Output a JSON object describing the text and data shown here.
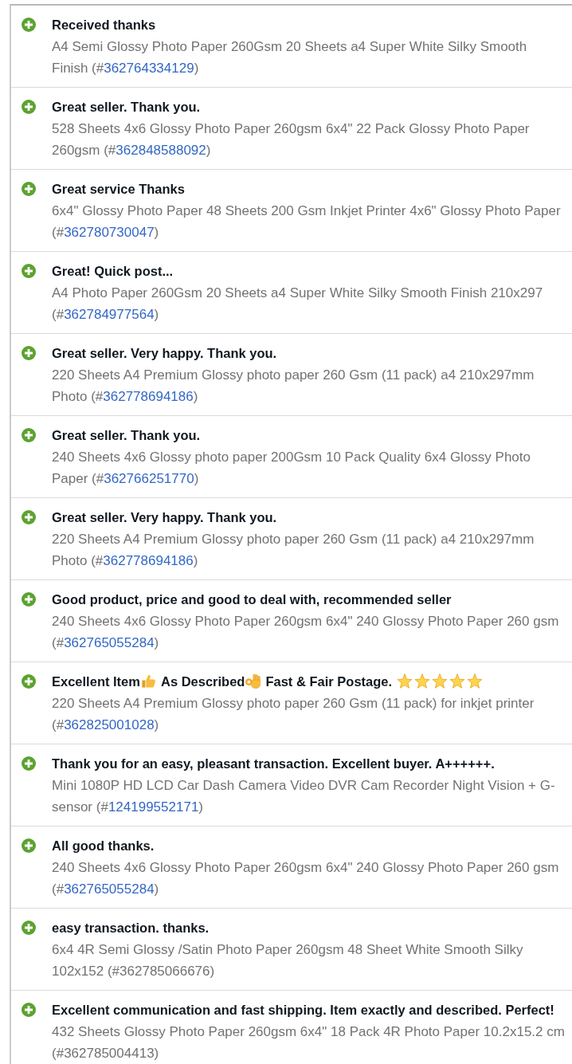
{
  "feedback": [
    {
      "positive": true,
      "comment": [
        {
          "kind": "text",
          "text": "Received thanks"
        }
      ],
      "item": "A4 Semi Glossy Photo Paper 260Gsm 20 Sheets a4 Super White Silky Smooth Finish",
      "open": "(#",
      "number": "362764334129",
      "close": ")",
      "linked": true
    },
    {
      "positive": true,
      "comment": [
        {
          "kind": "text",
          "text": "Great seller. Thank you."
        }
      ],
      "item": "528 Sheets 4x6 Glossy Photo Paper 260gsm 6x4\" 22 Pack Glossy Photo Paper 260gsm",
      "open": "(#",
      "number": "362848588092",
      "close": ")",
      "linked": true
    },
    {
      "positive": true,
      "comment": [
        {
          "kind": "text",
          "text": "Great service Thanks"
        }
      ],
      "item": "6x4\" Glossy Photo Paper 48 Sheets 200 Gsm Inkjet Printer 4x6\" Glossy Photo Paper",
      "open": "(#",
      "number": "362780730047",
      "close": ")",
      "linked": true
    },
    {
      "positive": true,
      "comment": [
        {
          "kind": "text",
          "text": "Great! Quick post..."
        }
      ],
      "item": "A4 Photo Paper 260Gsm 20 Sheets a4 Super White Silky Smooth Finish 210x297",
      "open": "(#",
      "number": "362784977564",
      "close": ")",
      "linked": true
    },
    {
      "positive": true,
      "comment": [
        {
          "kind": "text",
          "text": "Great seller. Very happy. Thank you."
        }
      ],
      "item": "220 Sheets A4 Premium Glossy photo paper 260 Gsm (11 pack) a4 210x297mm Photo",
      "open": "(#",
      "number": "362778694186",
      "close": ")",
      "linked": true
    },
    {
      "positive": true,
      "comment": [
        {
          "kind": "text",
          "text": "Great seller. Thank you."
        }
      ],
      "item": "240 Sheets 4x6 Glossy photo paper 200Gsm 10 Pack Quality 6x4 Glossy Photo Paper",
      "open": "(#",
      "number": "362766251770",
      "close": ")",
      "linked": true
    },
    {
      "positive": true,
      "comment": [
        {
          "kind": "text",
          "text": "Great seller. Very happy. Thank you."
        }
      ],
      "item": "220 Sheets A4 Premium Glossy photo paper 260 Gsm (11 pack) a4 210x297mm Photo",
      "open": "(#",
      "number": "362778694186",
      "close": ")",
      "linked": true
    },
    {
      "positive": true,
      "comment": [
        {
          "kind": "text",
          "text": "Good product, price and good to deal with, recommended seller"
        }
      ],
      "item": "240 Sheets 4x6 Glossy Photo Paper 260gsm 6x4\" 240 Glossy Photo Paper 260 gsm",
      "open": "(#",
      "number": "362765055284",
      "close": ")",
      "linked": true
    },
    {
      "positive": true,
      "comment": [
        {
          "kind": "text",
          "text": "Excellent Item"
        },
        {
          "kind": "thumbs_up"
        },
        {
          "kind": "text",
          "text": "As Described"
        },
        {
          "kind": "ok_hand"
        },
        {
          "kind": "text",
          "text": "Fast & Fair Postage."
        },
        {
          "kind": "star"
        },
        {
          "kind": "star"
        },
        {
          "kind": "star"
        },
        {
          "kind": "star"
        },
        {
          "kind": "star"
        }
      ],
      "item": "220 Sheets A4 Premium Glossy photo paper 260 Gsm (11 pack) for inkjet printer",
      "open": "(#",
      "number": "362825001028",
      "close": ")",
      "linked": true
    },
    {
      "positive": true,
      "comment": [
        {
          "kind": "text",
          "text": "Thank you for an easy, pleasant transaction. Excellent buyer. A++++++."
        }
      ],
      "item": "Mini 1080P HD LCD Car Dash Camera Video DVR Cam Recorder Night Vision + G-sensor",
      "open": "(#",
      "number": "124199552171",
      "close": ")",
      "linked": true
    },
    {
      "positive": true,
      "comment": [
        {
          "kind": "text",
          "text": "All good thanks."
        }
      ],
      "item": "240 Sheets 4x6 Glossy Photo Paper 260gsm 6x4\" 240 Glossy Photo Paper 260 gsm",
      "open": "(#",
      "number": "362765055284",
      "close": ")",
      "linked": true
    },
    {
      "positive": true,
      "comment": [
        {
          "kind": "text",
          "text": "easy transaction. thanks."
        }
      ],
      "item": "6x4 4R Semi Glossy /Satin Photo Paper 260gsm 48 Sheet White Smooth Silky 102x152",
      "open": "(#",
      "number": "362785066676",
      "close": ")",
      "linked": false
    },
    {
      "positive": true,
      "comment": [
        {
          "kind": "text",
          "text": "Excellent communication and fast shipping. Item exactly and described. Perfect!"
        }
      ],
      "item": "432 Sheets Glossy Photo Paper 260gsm 6x4\" 18 Pack 4R Photo Paper 10.2x15.2 cm",
      "open": "(#",
      "number": "362785004413",
      "close": ")",
      "linked": false
    }
  ]
}
